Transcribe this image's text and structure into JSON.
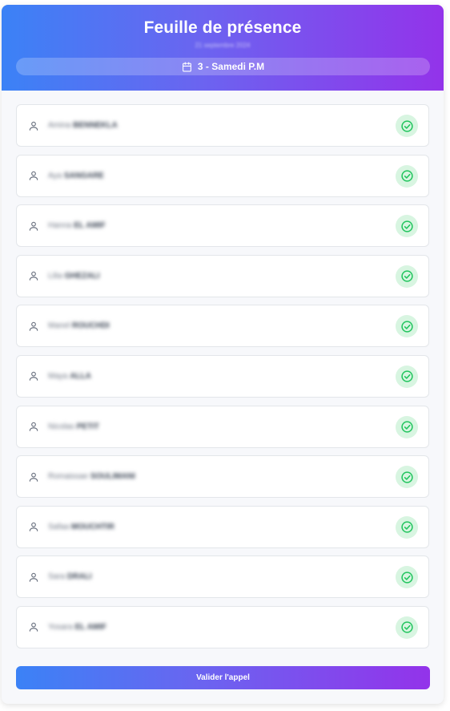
{
  "header": {
    "title": "Feuille de présence",
    "date": "21 septembre 2024",
    "session": "3 - Samedi P.M"
  },
  "students": [
    {
      "first": "Amina",
      "last": "BENNEKLA",
      "present": true
    },
    {
      "first": "Aya",
      "last": "SANGARE",
      "present": true
    },
    {
      "first": "Hanna",
      "last": "EL AMIF",
      "present": true
    },
    {
      "first": "Lilia",
      "last": "GHEZALI",
      "present": true
    },
    {
      "first": "Manel",
      "last": "ROUCHDI",
      "present": true
    },
    {
      "first": "Maya",
      "last": "ALLA",
      "present": true
    },
    {
      "first": "Nicolas",
      "last": "PETIT",
      "present": true
    },
    {
      "first": "Romaissae",
      "last": "SOULIMANI",
      "present": true
    },
    {
      "first": "Safaa",
      "last": "MOUCHTIR",
      "present": true
    },
    {
      "first": "Sara",
      "last": "DRALI",
      "present": true
    },
    {
      "first": "Yosara",
      "last": "EL AMIF",
      "present": true
    }
  ],
  "footer": {
    "submit_label": "Valider l'appel"
  },
  "icons": {
    "session": "calendar-icon",
    "student": "user-icon",
    "status": "check-circle-icon"
  },
  "colors": {
    "gradient_start": "#3b82f6",
    "gradient_end": "#9333ea",
    "present": "#22c55e",
    "present_bg": "#d8f5e1"
  }
}
